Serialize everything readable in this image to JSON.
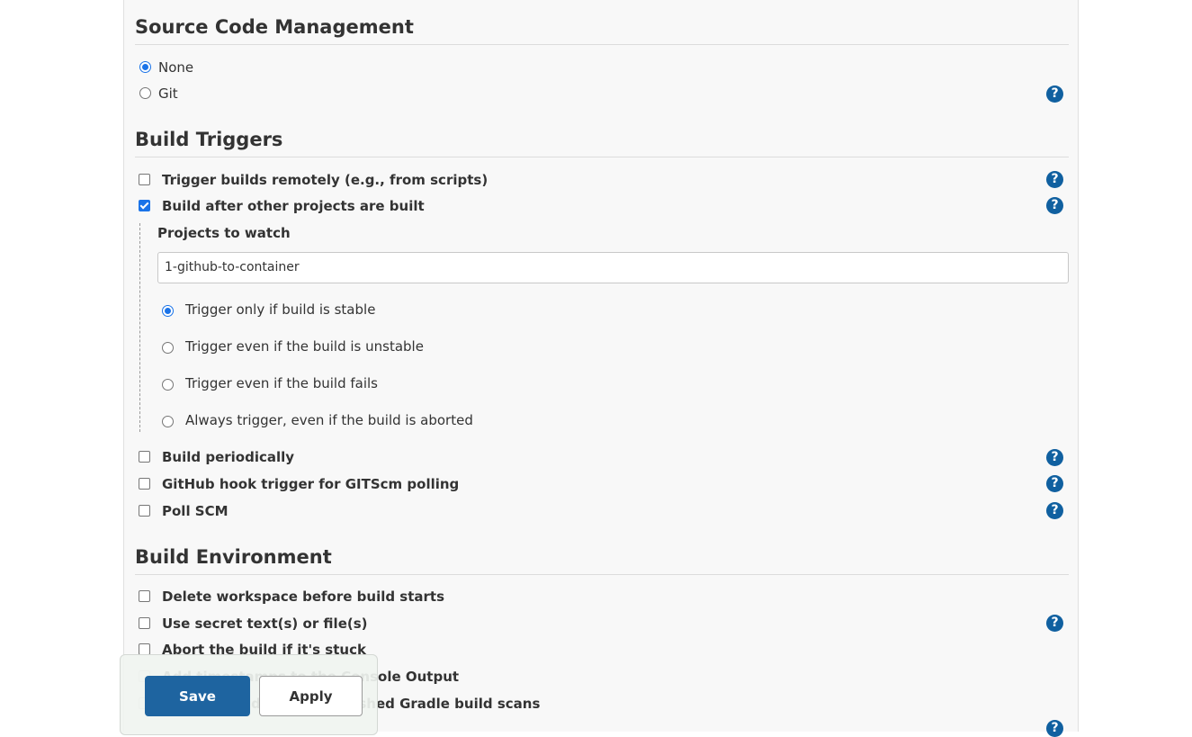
{
  "source_code_management": {
    "title": "Source Code Management",
    "options": [
      {
        "label": "None",
        "checked": true
      },
      {
        "label": "Git",
        "checked": false
      }
    ],
    "help": "?"
  },
  "build_triggers": {
    "title": "Build Triggers",
    "items": [
      {
        "label": "Trigger builds remotely (e.g., from scripts)",
        "checked": false
      },
      {
        "label": "Build after other projects are built",
        "checked": true
      },
      {
        "label": "Build periodically",
        "checked": false
      },
      {
        "label": "GitHub hook trigger for GITScm polling",
        "checked": false
      },
      {
        "label": "Poll SCM",
        "checked": false
      }
    ],
    "projects_to_watch": {
      "label": "Projects to watch",
      "value": "1-github-to-container"
    },
    "trigger_conditions": [
      {
        "label": "Trigger only if build is stable",
        "checked": true
      },
      {
        "label": "Trigger even if the build is unstable",
        "checked": false
      },
      {
        "label": "Trigger even if the build fails",
        "checked": false
      },
      {
        "label": "Always trigger, even if the build is aborted",
        "checked": false
      }
    ],
    "help": "?"
  },
  "build_environment": {
    "title": "Build Environment",
    "items": [
      {
        "label": "Delete workspace before build starts",
        "checked": false
      },
      {
        "label": "Use secret text(s) or file(s)",
        "checked": false
      },
      {
        "label": "Abort the build if it's stuck",
        "checked": false
      },
      {
        "label": "Add timestamps to the Console Output",
        "checked": false
      },
      {
        "label": "Inspect build log for published Gradle build scans",
        "checked": false
      }
    ],
    "help": "?"
  },
  "actions": {
    "save_label": "Save",
    "apply_label": "Apply"
  },
  "colors": {
    "accent": "#1a73e8",
    "save_button": "#1e64a0",
    "help_icon": "#1060a0"
  }
}
